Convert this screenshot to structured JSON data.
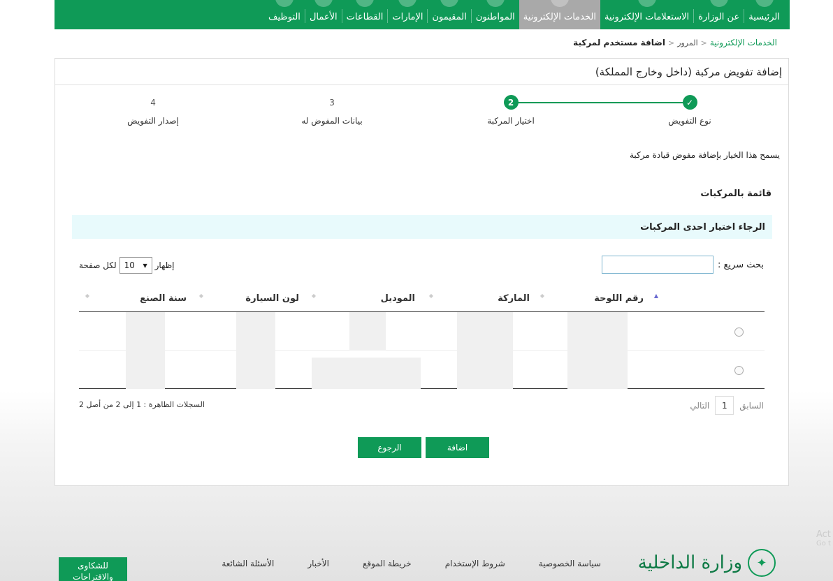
{
  "nav": {
    "items": [
      {
        "label": "الرئيسية",
        "active": false
      },
      {
        "label": "عن الوزارة",
        "active": false
      },
      {
        "label": "الاستعلامات الإلكترونية",
        "active": false
      },
      {
        "label": "الخدمات الإلكترونية",
        "active": true
      },
      {
        "label": "المواطنون",
        "active": false
      },
      {
        "label": "المقيمون",
        "active": false
      },
      {
        "label": "الإمارات",
        "active": false
      },
      {
        "label": "القطاعات",
        "active": false
      },
      {
        "label": "الأعمال",
        "active": false
      },
      {
        "label": "التوظيف",
        "active": false
      }
    ]
  },
  "breadcrumb": {
    "root": "الخدمات الإلكترونية",
    "middle": "المرور",
    "current": "اضافة مستخدم لمركبة"
  },
  "panel": {
    "title": "إضافة تفويض مركبة (داخل وخارج المملكة)"
  },
  "stepper": {
    "steps": [
      {
        "marker": "✓",
        "label": "نوع التفويض",
        "state": "done"
      },
      {
        "marker": "2",
        "label": "اختيار المركبة",
        "state": "current"
      },
      {
        "marker": "3",
        "label": "بيانات المفوض له",
        "state": "todo"
      },
      {
        "marker": "4",
        "label": "إصدار التفويض",
        "state": "todo"
      }
    ]
  },
  "info_text": "يسمح هذا الخيار بإضافة مفوض قيادة مركبة",
  "vehicles_title": "قائمة بالمركبات",
  "select_prompt": "الرجاء اختيار احدى المركبات",
  "search": {
    "label": "بحث سريع :",
    "value": ""
  },
  "length": {
    "show": "إظهار",
    "value": "10",
    "per_page": "لكل صفحة"
  },
  "table": {
    "columns": [
      "رقم اللوحة",
      "الماركة",
      "الموديل",
      "لون السيارة",
      "سنة الصنع"
    ],
    "rows": [
      {
        "selected": false
      },
      {
        "selected": false
      }
    ]
  },
  "pager": {
    "previous": "السابق",
    "current_page": "1",
    "next": "التالي"
  },
  "records_info": "السجلات الظاهرة : 1 إلى 2 من أصل 2",
  "buttons": {
    "add": "اضافة",
    "back": "الرجوع"
  },
  "footer": {
    "ministry": "وزارة الداخلية",
    "links": [
      "سياسة الخصوصية",
      "شروط الإستخدام",
      "خريطة الموقع",
      "الأخبار",
      "الأسئلة الشائعة"
    ],
    "complaints": "للشكاوى والاقتراحات"
  },
  "watermark": {
    "line1": "Act",
    "line2": "Go t"
  },
  "colors": {
    "brand_green": "#0f9a57",
    "active_tab": "#a9a9a9",
    "prompt_bg": "#e8fafc"
  }
}
